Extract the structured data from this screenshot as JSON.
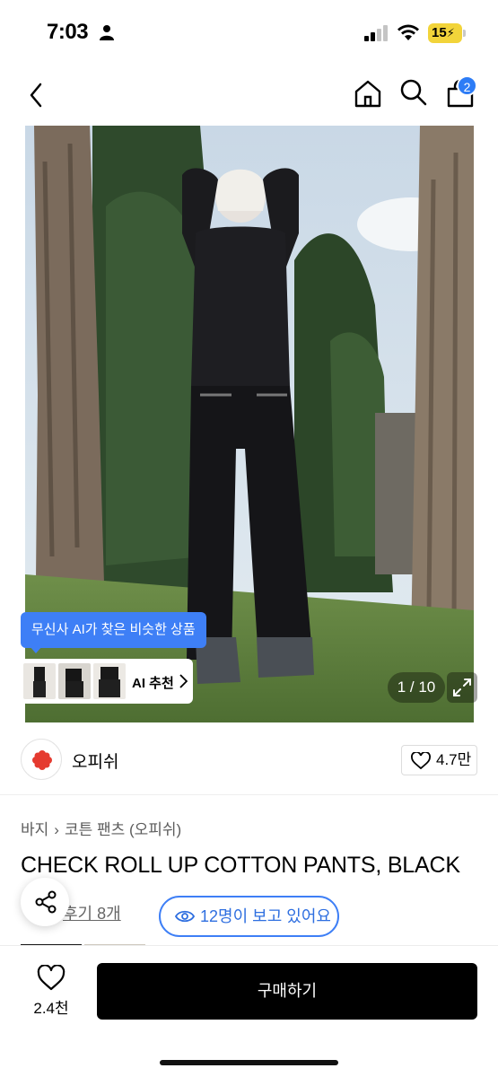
{
  "status_bar": {
    "time": "7:03",
    "battery": "15"
  },
  "header": {
    "cart_count": "2"
  },
  "hero": {
    "ai_tooltip": "무신사 AI가 찾은 비슷한 상품",
    "ai_recommend_label": "AI 추천",
    "pager": "1 / 10"
  },
  "brand": {
    "name": "오피쉬",
    "likes": "4.7만"
  },
  "breadcrumb": [
    "바지",
    "코튼 팬츠 (오피쉬)"
  ],
  "product": {
    "title": "CHECK ROLL UP COTTON PANTS, BLACK",
    "review_link": "후기 8개",
    "viewers": "12명이 보고 있어요"
  },
  "bottom_bar": {
    "wish_count": "2.4천",
    "buy_label": "구매하기"
  },
  "colors": {
    "accent": "#3e7ff6",
    "buy_button": "#000000",
    "battery": "#f2d43a"
  }
}
